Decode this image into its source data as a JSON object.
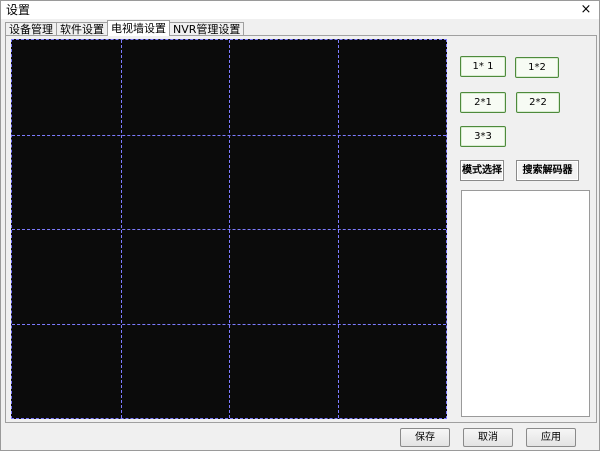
{
  "window": {
    "title": "设置",
    "close_glyph": "×"
  },
  "tabs": [
    {
      "label": "设备管理",
      "active": false
    },
    {
      "label": "软件设置",
      "active": false
    },
    {
      "label": "电视墙设置",
      "active": true
    },
    {
      "label": "NVR管理设置",
      "active": false
    }
  ],
  "video_wall": {
    "rows": 4,
    "columns": 4,
    "background_color": "#0b0b0b",
    "divider_color": "#7d7bff"
  },
  "layout_buttons": {
    "b1x1": "1* 1",
    "b1x2": "1*2",
    "b2x1": "2*1",
    "b2x2": "2*2",
    "b3x3": "3*3"
  },
  "actions": {
    "mode_select": "模式选择",
    "search_decoder": "搜索解码器"
  },
  "decoder_list": {
    "items": []
  },
  "footer": {
    "save": "保存",
    "cancel": "取消",
    "apply": "应用"
  },
  "colors": {
    "layout_button_border": "#4e8a3c",
    "window_background": "#f0f0f0"
  }
}
